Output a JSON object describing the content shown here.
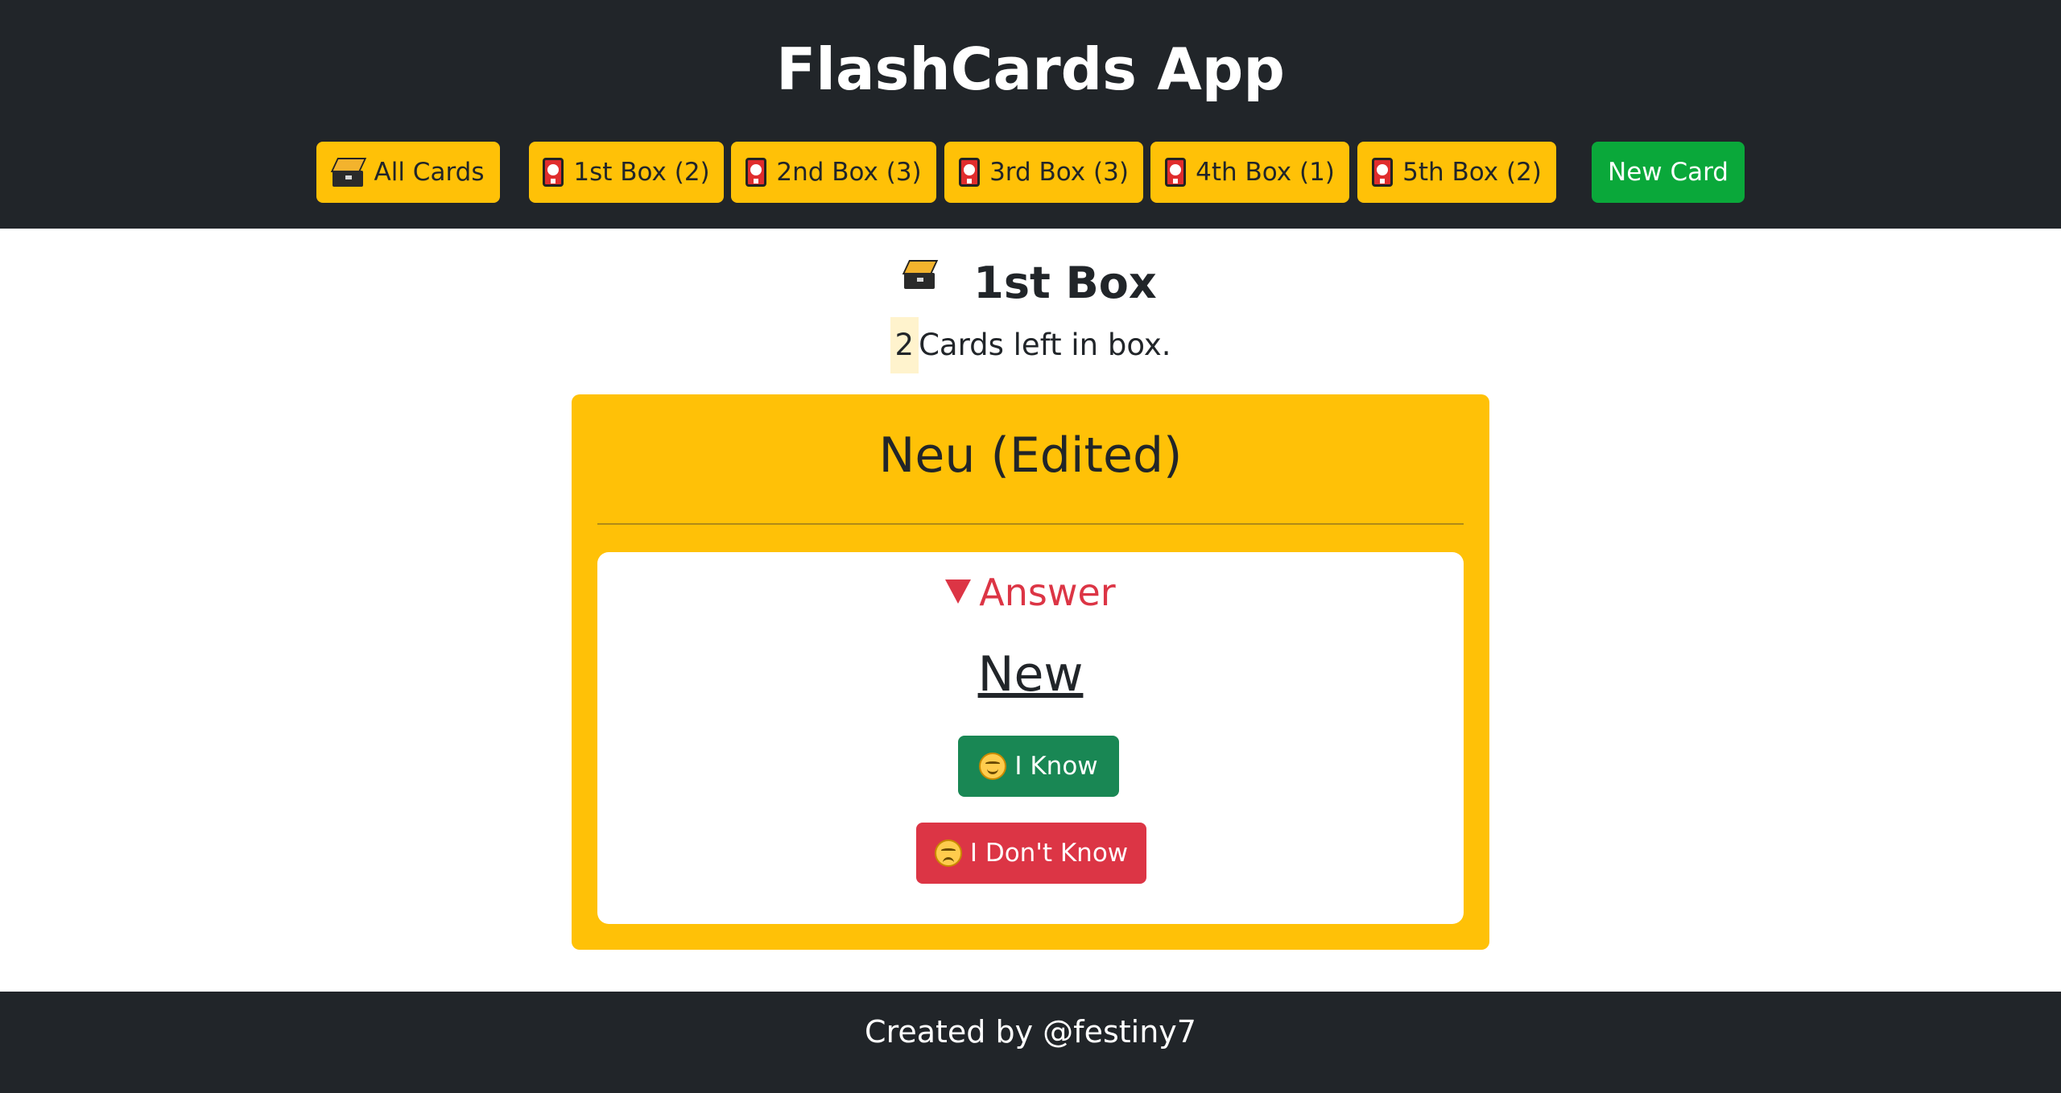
{
  "app": {
    "title": "FlashCards App"
  },
  "nav": {
    "all_cards_label": "All Cards",
    "boxes": [
      {
        "label": "1st Box (2)"
      },
      {
        "label": "2nd Box (3)"
      },
      {
        "label": "3rd Box (3)"
      },
      {
        "label": "4th Box (1)"
      },
      {
        "label": "5th Box (2)"
      }
    ],
    "new_card_label": "New Card",
    "icons": {
      "all_cards": "card-file-box-icon",
      "box": "red-card-icon"
    }
  },
  "main": {
    "box_title": "1st Box",
    "box_icon": "card-file-box-icon",
    "cards_left_count": "2",
    "cards_left_text": "Cards left in box."
  },
  "card": {
    "question": "Neu (Edited)",
    "answer_summary": "Answer",
    "answer": "New",
    "know_label": "I Know",
    "dont_know_label": "I Don't Know"
  },
  "footer": {
    "text": "Created by @festiny7"
  },
  "colors": {
    "header_bg": "#212529",
    "accent_yellow": "#ffc107",
    "new_card_green": "#0aa83a",
    "know_green": "#198754",
    "dont_know_red": "#dc3545",
    "answer_red": "#dc3545",
    "count_highlight": "#fff3cd"
  }
}
